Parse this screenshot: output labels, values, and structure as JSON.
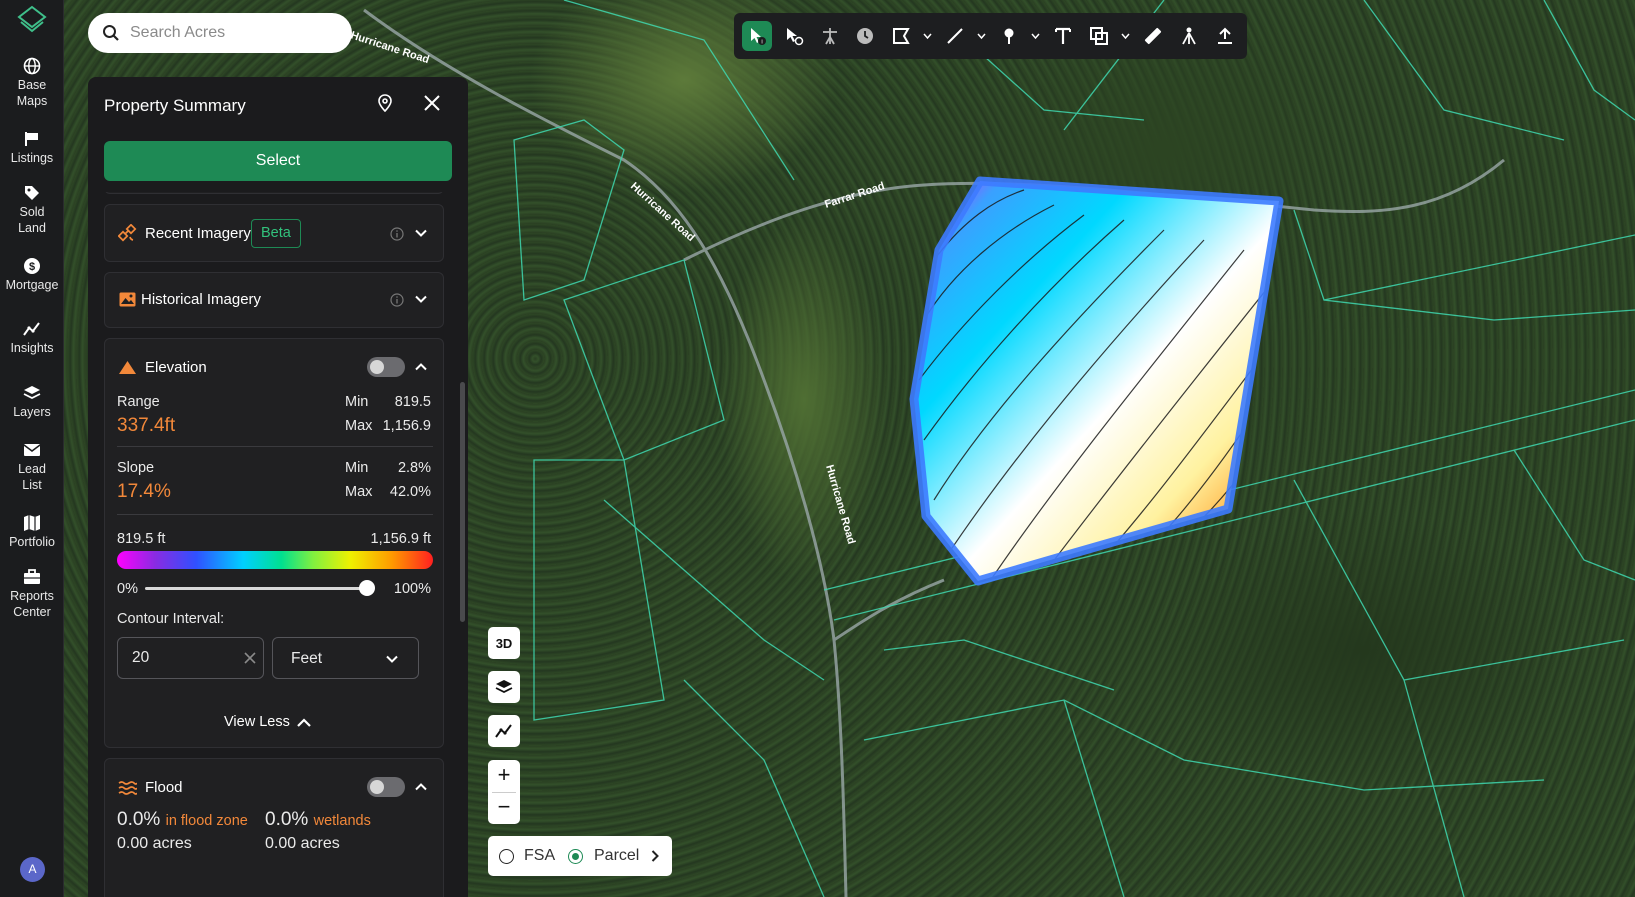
{
  "nav": {
    "items": [
      {
        "label_line1": "Base",
        "label_line2": "Maps",
        "icon": "globe-icon"
      },
      {
        "label_line1": "Listings",
        "label_line2": "",
        "icon": "flag-icon"
      },
      {
        "label_line1": "Sold",
        "label_line2": "Land",
        "icon": "tag-icon"
      },
      {
        "label_line1": "Mortgage",
        "label_line2": "",
        "icon": "dollar-icon"
      },
      {
        "label_line1": "Insights",
        "label_line2": "",
        "icon": "trend-icon"
      },
      {
        "label_line1": "Layers",
        "label_line2": "",
        "icon": "layers-icon"
      },
      {
        "label_line1": "Lead",
        "label_line2": "List",
        "icon": "mail-icon"
      },
      {
        "label_line1": "Portfolio",
        "label_line2": "",
        "icon": "map-icon"
      },
      {
        "label_line1": "Reports",
        "label_line2": "Center",
        "icon": "briefcase-icon"
      }
    ],
    "avatar_initial": "A"
  },
  "search": {
    "placeholder": "Search Acres"
  },
  "panel": {
    "title": "Property Summary",
    "select_label": "Select",
    "recent_imagery": {
      "label": "Recent Imagery",
      "badge": "Beta"
    },
    "historical_imagery": {
      "label": "Historical Imagery"
    },
    "elevation": {
      "label": "Elevation",
      "range_label": "Range",
      "range_value": "337.4ft",
      "range_min_label": "Min",
      "range_min": "819.5",
      "range_max_label": "Max",
      "range_max": "1,156.9",
      "slope_label": "Slope",
      "slope_value": "17.4%",
      "slope_min_label": "Min",
      "slope_min": "2.8%",
      "slope_max_label": "Max",
      "slope_max": "42.0%",
      "legend_low": "819.5 ft",
      "legend_high": "1,156.9 ft",
      "opacity_low": "0%",
      "opacity_high": "100%",
      "opacity_value": 1.0,
      "contour_label": "Contour Interval:",
      "contour_value": "20",
      "unit_value": "Feet",
      "view_less": "View Less"
    },
    "flood": {
      "label": "Flood",
      "flood_pct": "0.0%",
      "flood_caption": "in flood zone",
      "flood_acres": "0.00 acres",
      "wet_pct": "0.0%",
      "wet_caption": "wetlands",
      "wet_acres": "0.00 acres"
    }
  },
  "map": {
    "roads": [
      "Hurricane Road",
      "Hurricane Road",
      "Hurricane Road",
      "Farrar Road"
    ],
    "ctrl_3d": "3D",
    "layer_fsa": "FSA",
    "layer_parcel": "Parcel",
    "parcel_selected": "Parcel"
  },
  "colors": {
    "accent": "#1e8a55",
    "highlight": "#f2883a",
    "parcel_outline": "#3d7bff",
    "parcel_lines": "#3fd8b0"
  }
}
